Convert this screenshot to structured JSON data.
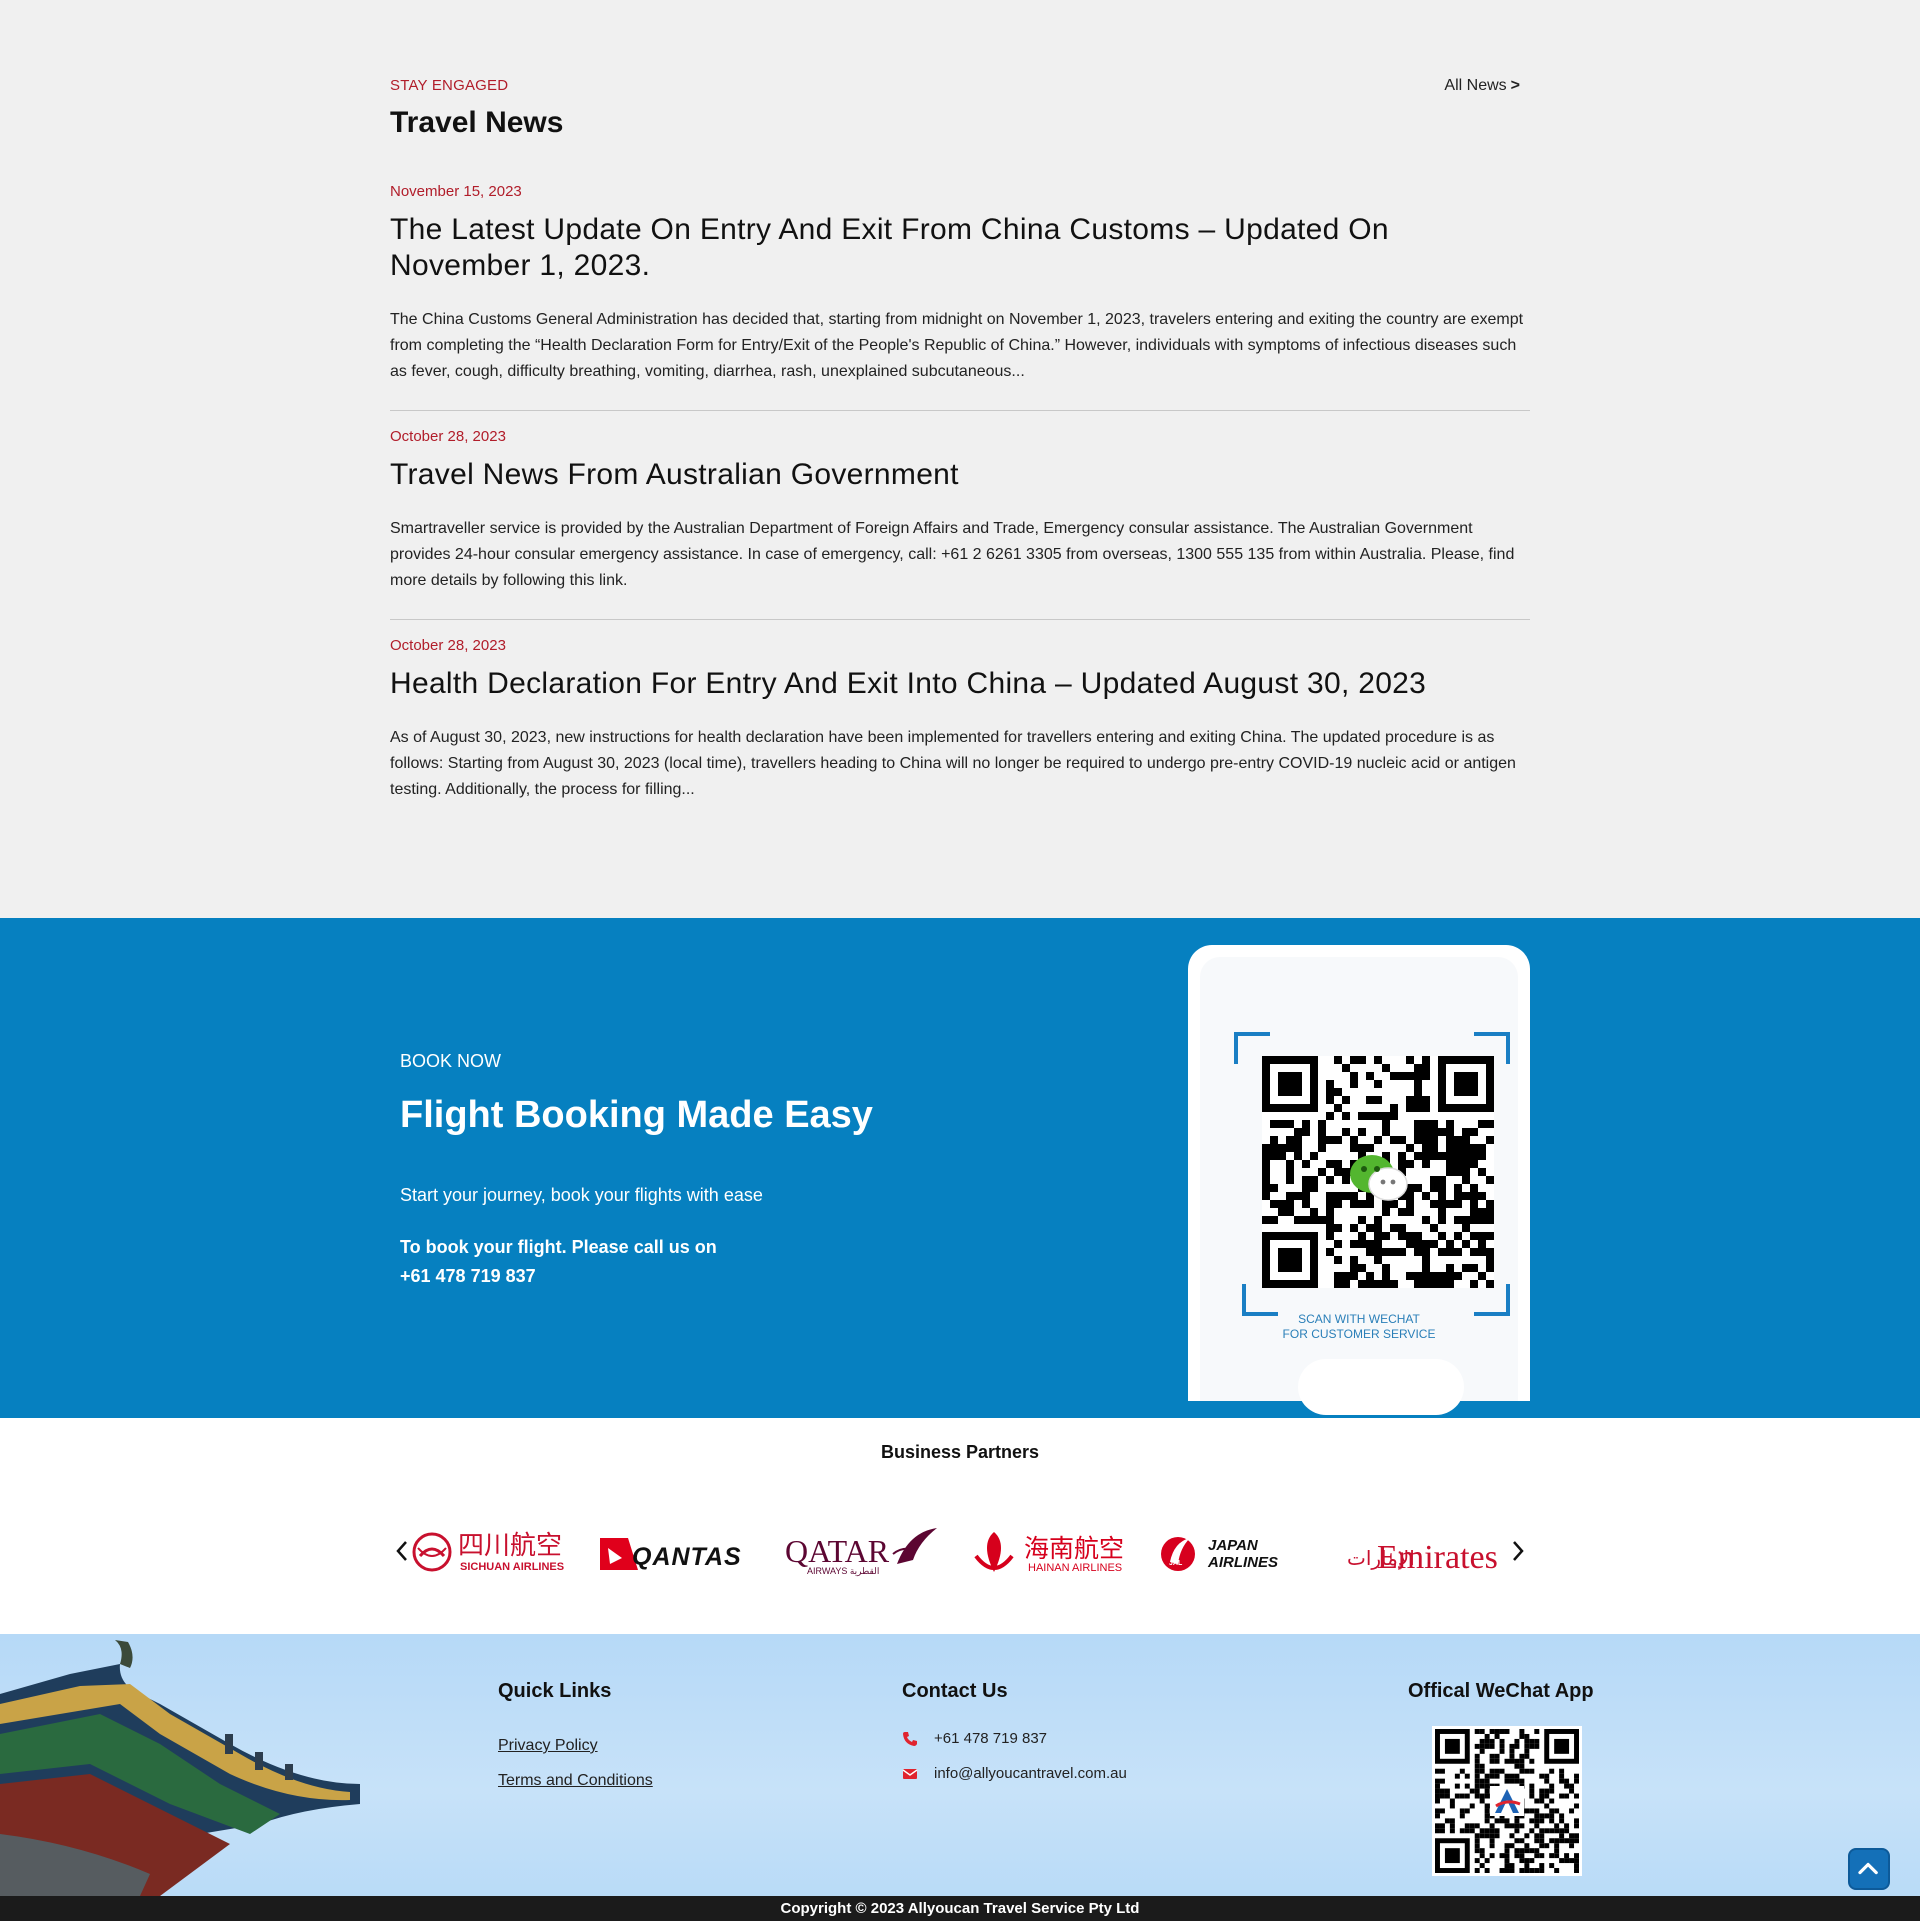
{
  "news": {
    "eyebrow": "STAY ENGAGED",
    "title": "Travel News",
    "all_news_label": "All News",
    "all_news_arrow": ">",
    "articles": [
      {
        "date": "November 15, 2023",
        "title": "The Latest Update On Entry And Exit From China Customs – Updated On November 1, 2023.",
        "excerpt": "The China Customs General Administration has decided that, starting from midnight on November 1, 2023, travelers entering and exiting the country are exempt from completing the “Health Declaration Form for Entry/Exit of the People's Republic of China.” However, individuals with symptoms of infectious diseases such as fever, cough, difficulty breathing, vomiting, diarrhea, rash, unexplained subcutaneous..."
      },
      {
        "date": "October 28, 2023",
        "title": "Travel News From Australian Government",
        "excerpt": "Smartraveller service is provided by the Australian Department of Foreign Affairs and Trade, Emergency consular assistance. The Australian Government provides 24-hour consular emergency assistance. In case of emergency, call: +61 2 6261 3305 from overseas, 1300 555 135 from within Australia. Please, find more details by following this link."
      },
      {
        "date": "October 28, 2023",
        "title": "Health Declaration For Entry And Exit Into China – Updated August 30, 2023",
        "excerpt": "As of August 30, 2023, new instructions for health declaration have been implemented for travellers entering and exiting China. The updated procedure is as follows: Starting from August 30, 2023 (local time), travellers heading to China will no longer be required to undergo pre-entry COVID-19 nucleic acid or antigen testing. Additionally, the process for filling..."
      }
    ]
  },
  "book": {
    "eyebrow": "BOOK NOW",
    "title": "Flight Booking Made Easy",
    "subtitle": "Start your journey, book your flights with ease",
    "call_line1": "To book your flight. Please call us on",
    "call_line2": "+61 478 719 837",
    "qr_caption_line1": "SCAN WITH WECHAT",
    "qr_caption_line2": "FOR CUSTOMER SERVICE"
  },
  "partners": {
    "title": "Business Partners",
    "logos": [
      {
        "name": "Sichuan Airlines",
        "cn": "四川航空",
        "en": "SICHUAN AIRLINES"
      },
      {
        "name": "Qantas",
        "en": "QANTAS"
      },
      {
        "name": "Qatar Airways",
        "en": "QATAR",
        "sub": "AIRWAYS القطرية"
      },
      {
        "name": "Hainan Airlines",
        "cn": "海南航空",
        "en": "HAINAN AIRLINES"
      },
      {
        "name": "Japan Airlines",
        "en1": "JAPAN",
        "en2": "AIRLINES",
        "mark": "JAL"
      },
      {
        "name": "Emirates",
        "en": "Emirates",
        "ar": "الإمارات"
      }
    ]
  },
  "footer": {
    "quick_links_title": "Quick Links",
    "quick_links": [
      "Privacy Policy",
      "Terms and Conditions"
    ],
    "contact_title": "Contact Us",
    "phone": "+61 478 719 837",
    "email": "info@allyoucantravel.com.au",
    "wechat_title": "Offical WeChat App",
    "copyright": "Copyright © 2023 Allyoucan Travel Service Pty Ltd"
  },
  "colors": {
    "accent_red": "#b11d2a",
    "brand_blue": "#0680c0",
    "footer_blue": "#b6d9f7",
    "copyright_bg": "#1b1b1b"
  },
  "icons": [
    "chevron-left-icon",
    "chevron-right-icon",
    "phone-icon",
    "mail-icon",
    "arrow-up-icon",
    "wechat-icon"
  ]
}
